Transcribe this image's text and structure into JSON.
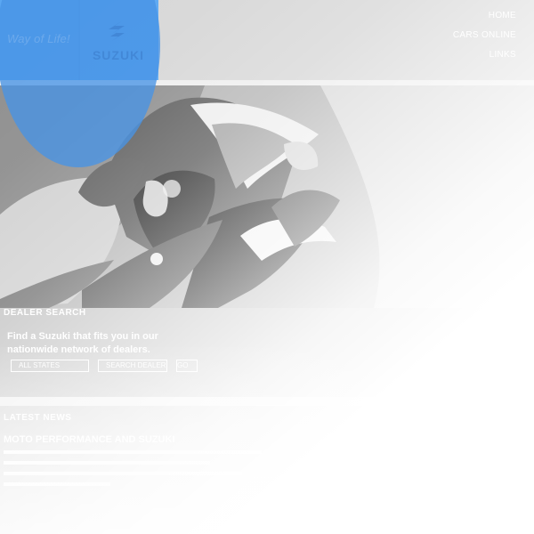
{
  "header": {
    "tagline": "Way of Life!",
    "logo_text": "SUZUKI",
    "nav": [
      {
        "label": "HOME"
      },
      {
        "label": "CARS ONLINE"
      },
      {
        "label": "LINKS"
      }
    ]
  },
  "dealer_search": {
    "title": "DEALER SEARCH",
    "copy": "Find a Suzuki that fits you in our nationwide network of dealers.",
    "select_value": "ALL STATES",
    "button_label": "SEARCH DEALER",
    "extra_button": "GO"
  },
  "latest_news": {
    "title": "LATEST NEWS",
    "headline": "MOTO PERFORMANCE AND SUZUKI"
  },
  "colors": {
    "brand_blue": "#5aa7f2",
    "logo_blue": "#2758a0",
    "overlay_blue": "#4893e6"
  },
  "icons": {
    "logo": "suzuki-s-logo-icon"
  }
}
